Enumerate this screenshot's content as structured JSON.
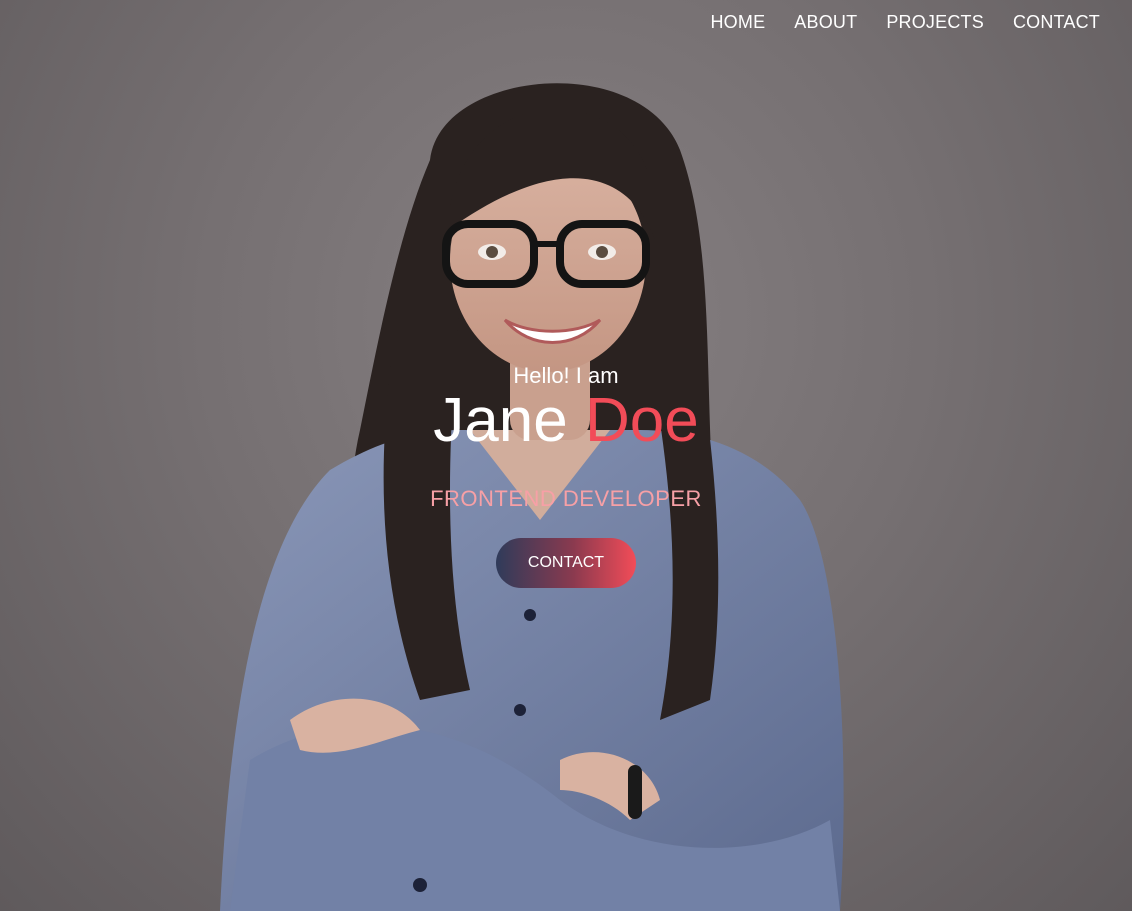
{
  "nav": {
    "items": [
      {
        "label": "HOME"
      },
      {
        "label": "ABOUT"
      },
      {
        "label": "PROJECTS"
      },
      {
        "label": "CONTACT"
      }
    ]
  },
  "hero": {
    "greeting": "Hello! I am",
    "first_name": "Jane",
    "last_name": "Doe",
    "role": "FRONTEND DEVELOPER",
    "cta_label": "CONTACT"
  },
  "colors": {
    "accent": "#f24c58",
    "role_text": "#f7a0a6",
    "button_gradient_start": "#2f3b5a",
    "button_gradient_end": "#f24c58",
    "background": "#767072"
  }
}
